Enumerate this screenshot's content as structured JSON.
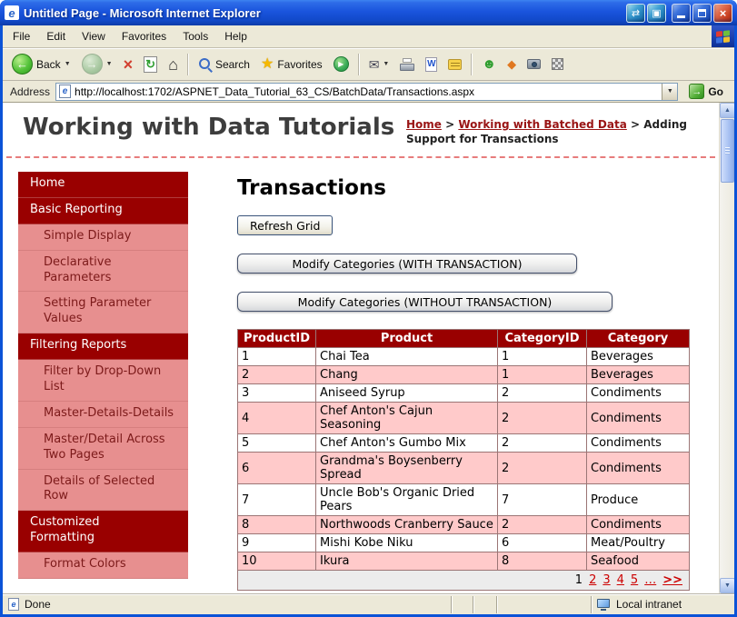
{
  "window": {
    "title": "Untitled Page - Microsoft Internet Explorer",
    "status_left": "Done",
    "status_right": "Local intranet"
  },
  "menu": {
    "items": [
      "File",
      "Edit",
      "View",
      "Favorites",
      "Tools",
      "Help"
    ]
  },
  "toolbar": {
    "back_label": "Back",
    "search_label": "Search",
    "favorites_label": "Favorites"
  },
  "address": {
    "label": "Address",
    "url": "http://localhost:1702/ASPNET_Data_Tutorial_63_CS/BatchData/Transactions.aspx",
    "go_label": "Go"
  },
  "icons": {
    "ie": "e",
    "swap_arrows": "⇄",
    "screen": "▣",
    "close": "×",
    "back": "←",
    "forward": "→",
    "dropdown": "▼",
    "stop": "×",
    "refresh": "↻",
    "home": "⌂",
    "favorites": "★",
    "media": "▶",
    "mail": "✉",
    "edit": "W",
    "messenger": "☻",
    "research": "◆",
    "go": "→",
    "arrow_up": "▲",
    "arrow_down": "▼"
  },
  "page": {
    "site_title": "Working with Data Tutorials",
    "breadcrumb": [
      {
        "label": "Home",
        "link": true
      },
      {
        "label": "Working with Batched Data",
        "link": true
      },
      {
        "label": "Adding Support for Transactions",
        "link": false
      }
    ],
    "heading": "Transactions",
    "refresh_button": "Refresh Grid",
    "with_transaction_button": "Modify Categories (WITH TRANSACTION)",
    "without_transaction_button": "Modify Categories (WITHOUT TRANSACTION)"
  },
  "sidebar": {
    "items": [
      {
        "label": "Home",
        "type": "category"
      },
      {
        "label": "Basic Reporting",
        "type": "category"
      },
      {
        "label": "Simple Display",
        "type": "child"
      },
      {
        "label": "Declarative Parameters",
        "type": "child"
      },
      {
        "label": "Setting Parameter Values",
        "type": "child"
      },
      {
        "label": "Filtering Reports",
        "type": "category"
      },
      {
        "label": "Filter by Drop-Down List",
        "type": "child"
      },
      {
        "label": "Master-Details-Details",
        "type": "child"
      },
      {
        "label": "Master/Detail Across Two Pages",
        "type": "child"
      },
      {
        "label": "Details of Selected Row",
        "type": "child"
      },
      {
        "label": "Customized Formatting",
        "type": "category"
      },
      {
        "label": "Format Colors",
        "type": "child"
      }
    ]
  },
  "table": {
    "columns": [
      "ProductID",
      "Product",
      "CategoryID",
      "Category"
    ],
    "rows": [
      [
        "1",
        "Chai Tea",
        "1",
        "Beverages"
      ],
      [
        "2",
        "Chang",
        "1",
        "Beverages"
      ],
      [
        "3",
        "Aniseed Syrup",
        "2",
        "Condiments"
      ],
      [
        "4",
        "Chef Anton's Cajun Seasoning",
        "2",
        "Condiments"
      ],
      [
        "5",
        "Chef Anton's Gumbo Mix",
        "2",
        "Condiments"
      ],
      [
        "6",
        "Grandma's Boysenberry Spread",
        "2",
        "Condiments"
      ],
      [
        "7",
        "Uncle Bob's Organic Dried Pears",
        "7",
        "Produce"
      ],
      [
        "8",
        "Northwoods Cranberry Sauce",
        "2",
        "Condiments"
      ],
      [
        "9",
        "Mishi Kobe Niku",
        "6",
        "Meat/Poultry"
      ],
      [
        "10",
        "Ikura",
        "8",
        "Seafood"
      ]
    ],
    "pager": {
      "current": "1",
      "pages": [
        "2",
        "3",
        "4",
        "5"
      ],
      "ellipsis": "…",
      "next": ">>"
    }
  },
  "colors": {
    "accent_maroon": "#990000",
    "sidebar_child_pink": "#e78f8f",
    "alt_row_pink": "#ffcaca",
    "pager_link_red": "#cc0000",
    "titlebar_blue": "#1a54dd"
  }
}
